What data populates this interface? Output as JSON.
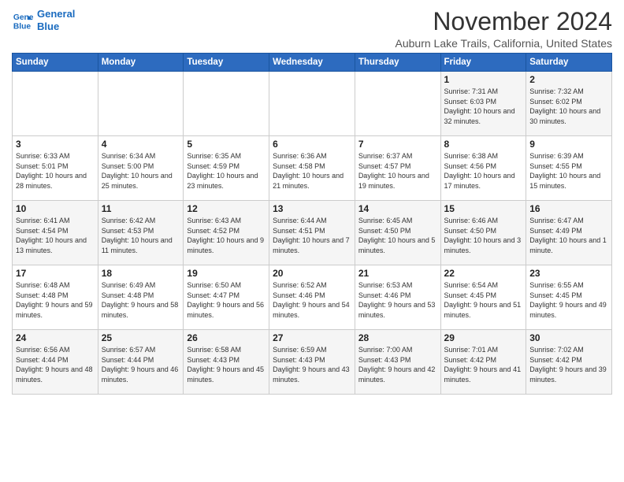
{
  "logo": {
    "line1": "General",
    "line2": "Blue"
  },
  "title": "November 2024",
  "subtitle": "Auburn Lake Trails, California, United States",
  "daylight_label": "Daylight hours",
  "headers": [
    "Sunday",
    "Monday",
    "Tuesday",
    "Wednesday",
    "Thursday",
    "Friday",
    "Saturday"
  ],
  "weeks": [
    [
      {
        "day": "",
        "info": ""
      },
      {
        "day": "",
        "info": ""
      },
      {
        "day": "",
        "info": ""
      },
      {
        "day": "",
        "info": ""
      },
      {
        "day": "",
        "info": ""
      },
      {
        "day": "1",
        "info": "Sunrise: 7:31 AM\nSunset: 6:03 PM\nDaylight: 10 hours and 32 minutes."
      },
      {
        "day": "2",
        "info": "Sunrise: 7:32 AM\nSunset: 6:02 PM\nDaylight: 10 hours and 30 minutes."
      }
    ],
    [
      {
        "day": "3",
        "info": "Sunrise: 6:33 AM\nSunset: 5:01 PM\nDaylight: 10 hours and 28 minutes."
      },
      {
        "day": "4",
        "info": "Sunrise: 6:34 AM\nSunset: 5:00 PM\nDaylight: 10 hours and 25 minutes."
      },
      {
        "day": "5",
        "info": "Sunrise: 6:35 AM\nSunset: 4:59 PM\nDaylight: 10 hours and 23 minutes."
      },
      {
        "day": "6",
        "info": "Sunrise: 6:36 AM\nSunset: 4:58 PM\nDaylight: 10 hours and 21 minutes."
      },
      {
        "day": "7",
        "info": "Sunrise: 6:37 AM\nSunset: 4:57 PM\nDaylight: 10 hours and 19 minutes."
      },
      {
        "day": "8",
        "info": "Sunrise: 6:38 AM\nSunset: 4:56 PM\nDaylight: 10 hours and 17 minutes."
      },
      {
        "day": "9",
        "info": "Sunrise: 6:39 AM\nSunset: 4:55 PM\nDaylight: 10 hours and 15 minutes."
      }
    ],
    [
      {
        "day": "10",
        "info": "Sunrise: 6:41 AM\nSunset: 4:54 PM\nDaylight: 10 hours and 13 minutes."
      },
      {
        "day": "11",
        "info": "Sunrise: 6:42 AM\nSunset: 4:53 PM\nDaylight: 10 hours and 11 minutes."
      },
      {
        "day": "12",
        "info": "Sunrise: 6:43 AM\nSunset: 4:52 PM\nDaylight: 10 hours and 9 minutes."
      },
      {
        "day": "13",
        "info": "Sunrise: 6:44 AM\nSunset: 4:51 PM\nDaylight: 10 hours and 7 minutes."
      },
      {
        "day": "14",
        "info": "Sunrise: 6:45 AM\nSunset: 4:50 PM\nDaylight: 10 hours and 5 minutes."
      },
      {
        "day": "15",
        "info": "Sunrise: 6:46 AM\nSunset: 4:50 PM\nDaylight: 10 hours and 3 minutes."
      },
      {
        "day": "16",
        "info": "Sunrise: 6:47 AM\nSunset: 4:49 PM\nDaylight: 10 hours and 1 minute."
      }
    ],
    [
      {
        "day": "17",
        "info": "Sunrise: 6:48 AM\nSunset: 4:48 PM\nDaylight: 9 hours and 59 minutes."
      },
      {
        "day": "18",
        "info": "Sunrise: 6:49 AM\nSunset: 4:48 PM\nDaylight: 9 hours and 58 minutes."
      },
      {
        "day": "19",
        "info": "Sunrise: 6:50 AM\nSunset: 4:47 PM\nDaylight: 9 hours and 56 minutes."
      },
      {
        "day": "20",
        "info": "Sunrise: 6:52 AM\nSunset: 4:46 PM\nDaylight: 9 hours and 54 minutes."
      },
      {
        "day": "21",
        "info": "Sunrise: 6:53 AM\nSunset: 4:46 PM\nDaylight: 9 hours and 53 minutes."
      },
      {
        "day": "22",
        "info": "Sunrise: 6:54 AM\nSunset: 4:45 PM\nDaylight: 9 hours and 51 minutes."
      },
      {
        "day": "23",
        "info": "Sunrise: 6:55 AM\nSunset: 4:45 PM\nDaylight: 9 hours and 49 minutes."
      }
    ],
    [
      {
        "day": "24",
        "info": "Sunrise: 6:56 AM\nSunset: 4:44 PM\nDaylight: 9 hours and 48 minutes."
      },
      {
        "day": "25",
        "info": "Sunrise: 6:57 AM\nSunset: 4:44 PM\nDaylight: 9 hours and 46 minutes."
      },
      {
        "day": "26",
        "info": "Sunrise: 6:58 AM\nSunset: 4:43 PM\nDaylight: 9 hours and 45 minutes."
      },
      {
        "day": "27",
        "info": "Sunrise: 6:59 AM\nSunset: 4:43 PM\nDaylight: 9 hours and 43 minutes."
      },
      {
        "day": "28",
        "info": "Sunrise: 7:00 AM\nSunset: 4:43 PM\nDaylight: 9 hours and 42 minutes."
      },
      {
        "day": "29",
        "info": "Sunrise: 7:01 AM\nSunset: 4:42 PM\nDaylight: 9 hours and 41 minutes."
      },
      {
        "day": "30",
        "info": "Sunrise: 7:02 AM\nSunset: 4:42 PM\nDaylight: 9 hours and 39 minutes."
      }
    ]
  ]
}
